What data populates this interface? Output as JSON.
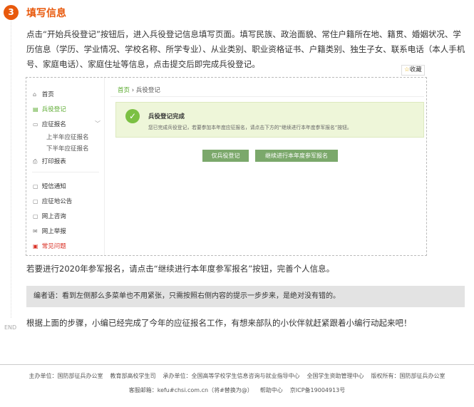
{
  "step": {
    "number": "3",
    "title": "填写信息",
    "description": "点击“开始兵役登记”按钮后，进入兵役登记信息填写页面。填写民族、政治面貌、常住户籍所在地、籍贯、婚姻状况、学历信息（学历、学业情况、学校名称、所学专业）、从业类别、职业资格证书、户籍类别、独生子女、联系电话（本人手机号、家庭电话）、家庭住址等信息，点击提交后即完成兵役登记。",
    "favorite": "收藏"
  },
  "screenshot": {
    "sidebar": [
      {
        "label": "首页",
        "icon": "home-icon"
      },
      {
        "label": "兵役登记",
        "icon": "register-icon"
      },
      {
        "label": "应征报名",
        "icon": "signup-icon"
      },
      {
        "label": "上半年应征报名",
        "icon": ""
      },
      {
        "label": "下半年应征报名",
        "icon": ""
      },
      {
        "label": "打印报表",
        "icon": "print-icon"
      },
      {
        "label": "短信通知",
        "icon": "sms-icon"
      },
      {
        "label": "应征地公告",
        "icon": "announcement-icon"
      },
      {
        "label": "网上咨询",
        "icon": "chat-icon"
      },
      {
        "label": "网上举报",
        "icon": "mail-icon"
      },
      {
        "label": "常见问题",
        "icon": "question-icon"
      }
    ],
    "breadcrumb": {
      "home": "首页",
      "sep": "›",
      "current": "兵役登记"
    },
    "notice": {
      "title": "兵役登记完成",
      "text": "您已完成兵役登记，若要参加本年度应征报名，请点击下方的“继续进行本年度参军报名”按钮。"
    },
    "buttons": {
      "only_register": "仅兵役登记",
      "continue": "继续进行本年度参军报名"
    }
  },
  "after_text": "若要进行2020年参军报名，请点击“继续进行本年度参军报名”按钮，完善个人信息。",
  "editor_note": "编者语：看到左侧那么多菜单也不用紧张，只需按照右侧内容的提示一步步来，是绝对没有错的。",
  "end_label": "END",
  "final_text": "根据上面的步骤，小编已经完成了今年的应征报名工作，有想来部队的小伙伴就赶紧跟着小编行动起来吧！",
  "footer": {
    "host": "主办单位：国防部征兵办公室",
    "host2": "教育部高校学生司",
    "organizer": "承办单位：全国高等学校学生信息咨询与就业指导中心",
    "organizer2": "全国学生资助管理中心",
    "copyright": "版权所有：国防部征兵办公室",
    "email": "客服邮箱：kefu#chsi.com.cn（将#替换为@）",
    "help": "帮助中心",
    "icp": "京ICP备19004913号"
  },
  "colors": {
    "accent": "#e8590c",
    "green": "#5aaa2e",
    "button": "#7ba86b"
  }
}
